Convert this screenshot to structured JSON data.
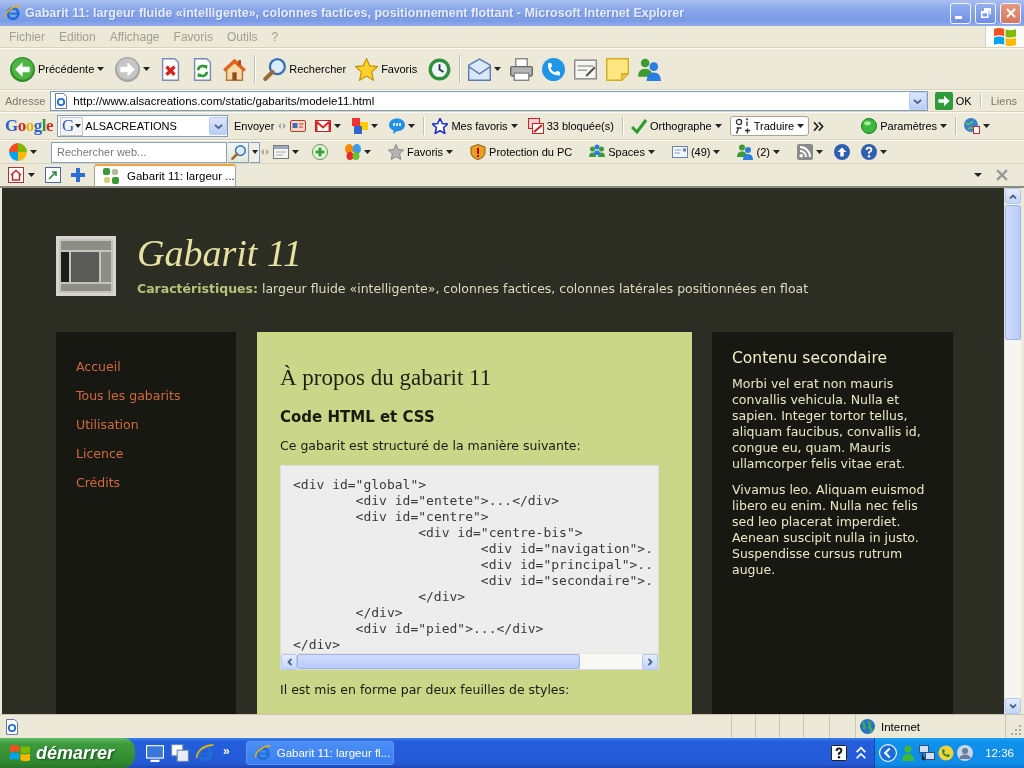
{
  "window": {
    "title": "Gabarit 11: largeur fluide «intelligente», colonnes factices, positionnement flottant - Microsoft Internet Explorer",
    "active": false
  },
  "menu": [
    "Fichier",
    "Edition",
    "Affichage",
    "Favoris",
    "Outils",
    "?"
  ],
  "toolbar": [
    {
      "kind": "back",
      "label": "Précédente"
    },
    {
      "kind": "forward"
    },
    {
      "kind": "stop"
    },
    {
      "kind": "refresh"
    },
    {
      "kind": "home"
    },
    {
      "kind": "search",
      "label": "Rechercher"
    },
    {
      "kind": "favorites",
      "label": "Favoris"
    },
    {
      "kind": "history"
    },
    {
      "kind": "mail"
    },
    {
      "kind": "print"
    },
    {
      "kind": "call"
    },
    {
      "kind": "edit"
    },
    {
      "kind": "note"
    },
    {
      "kind": "messenger"
    }
  ],
  "address_bar": {
    "label": "Adresse",
    "value": "http://www.alsacreations.com/static/gabarits/modele11.html",
    "go": "OK",
    "links": "Liens"
  },
  "google_toolbar": {
    "logo": "Google",
    "engine": "G",
    "query": "ALSACREATIONS",
    "items": [
      {
        "kind": "send",
        "label": "Envoyer"
      },
      {
        "kind": "card"
      },
      {
        "kind": "gmail"
      },
      {
        "kind": "blocks"
      },
      {
        "kind": "chat"
      },
      {
        "kind": "bookmarks",
        "label": "Mes favoris"
      },
      {
        "kind": "popups",
        "label": "33 bloquée(s)"
      },
      {
        "kind": "spelling",
        "label": "Orthographe"
      },
      {
        "kind": "translate",
        "label": "Traduire"
      },
      {
        "kind": "more"
      },
      {
        "kind": "settings",
        "label": "Paramètres"
      },
      {
        "kind": "options"
      }
    ]
  },
  "live_toolbar": {
    "search": {
      "placeholder": "Rechercher web..."
    },
    "items": [
      {
        "kind": "window"
      },
      {
        "kind": "add"
      },
      {
        "kind": "butterfly"
      },
      {
        "kind": "favorites",
        "label": "Favoris"
      },
      {
        "kind": "protection",
        "label": "Protection du PC"
      },
      {
        "kind": "spaces",
        "label": "Spaces"
      },
      {
        "kind": "mail",
        "label": "(49)"
      },
      {
        "kind": "contacts",
        "label": "(2)"
      },
      {
        "kind": "rss"
      },
      {
        "kind": "upload"
      },
      {
        "kind": "help"
      }
    ]
  },
  "tabs": [
    {
      "label": "Gabarit 11: largeur ...",
      "selected": true
    }
  ],
  "page": {
    "header": {
      "title": "Gabarit 11",
      "features": "**Caractéristiques:** largeur fluide «intelligente», colonnes factices, colonnes latérales positionnées en float"
    },
    "navigation": [
      "Accueil",
      "Tous les gabarits",
      "Utilisation",
      "Licence",
      "Crédits"
    ],
    "main": {
      "heading": "À propos du gabarit 11",
      "subheading": "Code HTML et CSS",
      "intro": "Ce gabarit est structuré de la manière suivante:",
      "code": [
        {
          "text": "<div id=\"global\">",
          "children": [
            {
              "text": "<div id=\"entete\">...</div>"
            },
            {
              "text": "<div id=\"centre\">",
              "children": [
                {
                  "text": "<div id=\"centre-bis\">",
                  "children": [
                    {
                      "text": "<div id=\"navigation\">."
                    },
                    {
                      "text": "<div id=\"principal\">.."
                    },
                    {
                      "text": "<div id=\"secondaire\">."
                    }
                  ]
                },
                {
                  "text": "</div>"
                }
              ]
            },
            {
              "text": "</div>"
            },
            {
              "text": "<div id=\"pied\">...</div>"
            }
          ]
        },
        {
          "text": "</div>"
        }
      ],
      "outro": "Il est mis en forme par deux feuilles de styles:"
    },
    "secondary": {
      "heading": "Contenu secondaire",
      "paragraphs": [
        "Morbi vel erat non mauris convallis vehicula. Nulla et sapien. Integer tortor tellus, aliquam faucibus, convallis id, congue eu, quam. Mauris ullamcorper felis vitae erat.",
        "Vivamus leo. Aliquam euismod libero eu enim. Nulla nec felis sed leo placerat imperdiet. Aenean suscipit nulla in justo. Suspendisse cursus rutrum augue."
      ]
    }
  },
  "status_bar": {
    "zone": "Internet"
  },
  "taskbar": {
    "start": "démarrer",
    "quick_launch_more": "»",
    "tasks": [
      {
        "label": "Gabarit 11: largeur fl...",
        "selected": false
      }
    ],
    "clock": "12:36"
  }
}
